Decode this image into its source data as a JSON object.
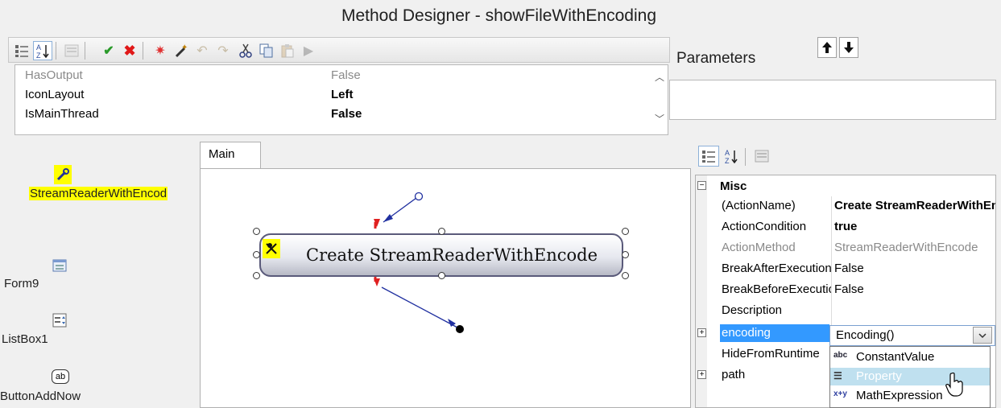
{
  "window": {
    "title": "Method Designer - showFileWithEncoding"
  },
  "toolbar": {
    "buttons": [
      "categorized-icon",
      "alphabetical-icon",
      "property-pages-icon",
      "accept-icon",
      "cancel-icon",
      "debug-icon",
      "magic-wand-icon",
      "undo-icon",
      "redo-icon",
      "cut-icon",
      "copy-icon",
      "paste-icon",
      "run-icon"
    ]
  },
  "parameters": {
    "label": "Parameters"
  },
  "method_properties": [
    {
      "name": "HasOutput",
      "value": "False",
      "disabled": true
    },
    {
      "name": "IconLayout",
      "value": "Left",
      "bold": true
    },
    {
      "name": "IsMainThread",
      "value": "False",
      "bold": true
    }
  ],
  "toolbox": {
    "items": [
      {
        "label": "StreamReaderWithEncod",
        "icon": "stream-reader-icon",
        "selected": true
      },
      {
        "label": "Form9",
        "icon": "form-icon"
      },
      {
        "label": "ListBox1",
        "icon": "listbox-icon"
      },
      {
        "label": "ButtonAddNow",
        "icon": "button-icon",
        "icon_text": "ab"
      }
    ]
  },
  "designer": {
    "tab": "Main",
    "action_label": "Create StreamReaderWithEncode"
  },
  "property_grid": {
    "category": "Misc",
    "rows": [
      {
        "name": "(ActionName)",
        "value": "Create StreamReaderWithEncode",
        "bold_value": true
      },
      {
        "name": "ActionCondition",
        "value": "true",
        "bold_value": true
      },
      {
        "name": "ActionMethod",
        "value": "StreamReaderWithEncode",
        "disabled": true
      },
      {
        "name": "BreakAfterExecution",
        "value": "False"
      },
      {
        "name": "BreakBeforeExecution",
        "value": "False"
      },
      {
        "name": "Description",
        "value": ""
      },
      {
        "name": "encoding",
        "value": "Encoding()",
        "selected": true,
        "expandable": true
      },
      {
        "name": "HideFromRuntime",
        "value": ""
      },
      {
        "name": "path",
        "value": "",
        "expandable": true
      }
    ]
  },
  "dropdown": {
    "value": "Encoding()",
    "options": [
      {
        "icon_text": "abc",
        "label": "ConstantValue"
      },
      {
        "icon_text": "☰",
        "label": "Property",
        "highlighted": true
      },
      {
        "icon_text": "x+y",
        "label": "MathExpression"
      }
    ]
  },
  "colors": {
    "selection": "#3399ff",
    "toolbox_highlight": "#ffff00",
    "dropdown_highlight": "#bfe0ef",
    "connector": "#2030a0",
    "arrow_red": "#e02020"
  }
}
